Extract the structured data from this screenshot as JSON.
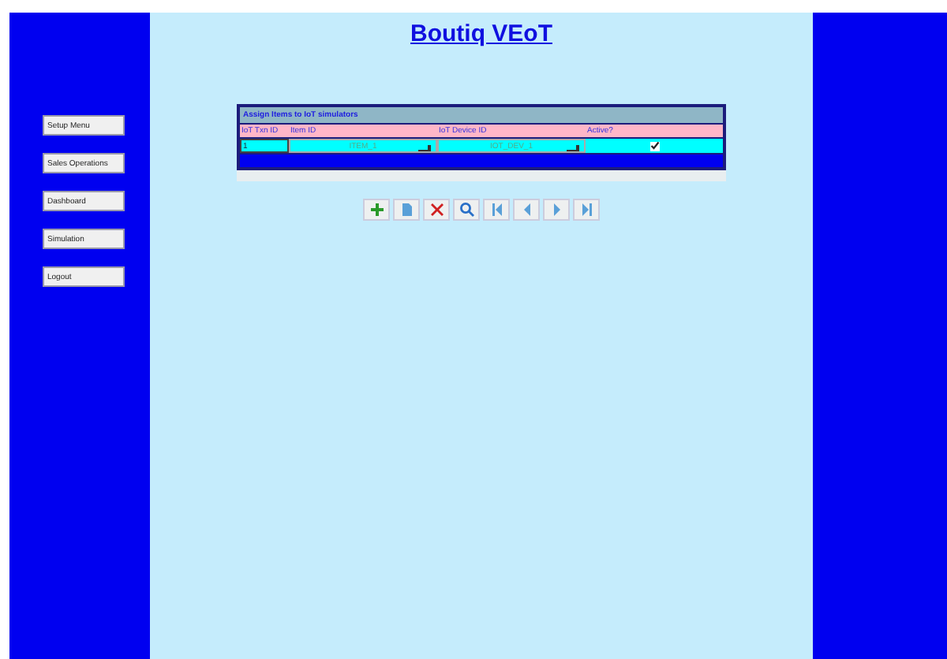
{
  "title": "Boutiq VEoT",
  "menu": [
    {
      "label": "Setup Menu"
    },
    {
      "label": "Sales Operations"
    },
    {
      "label": "Dashboard"
    },
    {
      "label": "Simulation"
    },
    {
      "label": "Logout"
    }
  ],
  "grid": {
    "caption": "Assign Items to IoT simulators",
    "columns": [
      "IoT Txn ID",
      "Item ID",
      "IoT Device ID",
      "Active?"
    ],
    "rows": [
      {
        "txn_id": "1",
        "item_id": "ITEM_1",
        "device_id": "IOT_DEV_1",
        "checked": true
      }
    ]
  },
  "toolbar": [
    {
      "kind": "add"
    },
    {
      "kind": "edit"
    },
    {
      "kind": "delete"
    },
    {
      "kind": "search"
    },
    {
      "kind": "first"
    },
    {
      "kind": "prev"
    },
    {
      "kind": "next"
    },
    {
      "kind": "last"
    }
  ]
}
